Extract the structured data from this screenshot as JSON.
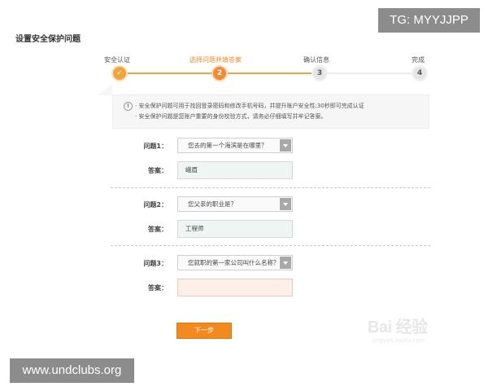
{
  "page_title": "设置安全保护问题",
  "overlays": {
    "tg": "TG: MYYJJPP",
    "site": "www.undclubs.org"
  },
  "steps": [
    {
      "label": "安全认证",
      "marker": "✓",
      "state": "done"
    },
    {
      "label": "选择问题并填答案",
      "marker": "2",
      "state": "current"
    },
    {
      "label": "确认信息",
      "marker": "3",
      "state": "todo"
    },
    {
      "label": "完成",
      "marker": "4",
      "state": "todo"
    }
  ],
  "notice": {
    "icon": "!",
    "line1": "· 安全保护问题可用于找回登录密码和修改手机号码，并提升账户安全性;30秒即可完成认证",
    "line2": "· 安全保护问题是您账户重要的身份校验方式，请务必仔细填写并牢记答案。"
  },
  "questions": [
    {
      "q_label": "问题1：",
      "q_value": "您去的第一个海滨是在哪里？",
      "a_label": "答案：",
      "a_value": "峨眉"
    },
    {
      "q_label": "问题2：",
      "q_value": "您父亲的职业是？",
      "a_label": "答案：",
      "a_value": "工程师"
    },
    {
      "q_label": "问题3：",
      "q_value": "您就职的第一家公司叫什么名称？",
      "a_label": "答案：",
      "a_value": ""
    }
  ],
  "next_button": "下一步",
  "watermark": {
    "text": "Bai 经验",
    "sub": "jingyan.baidu.com"
  },
  "colors": {
    "accent": "#f08b2e",
    "button": "#f28a1f",
    "todo": "#e6e6e6"
  }
}
